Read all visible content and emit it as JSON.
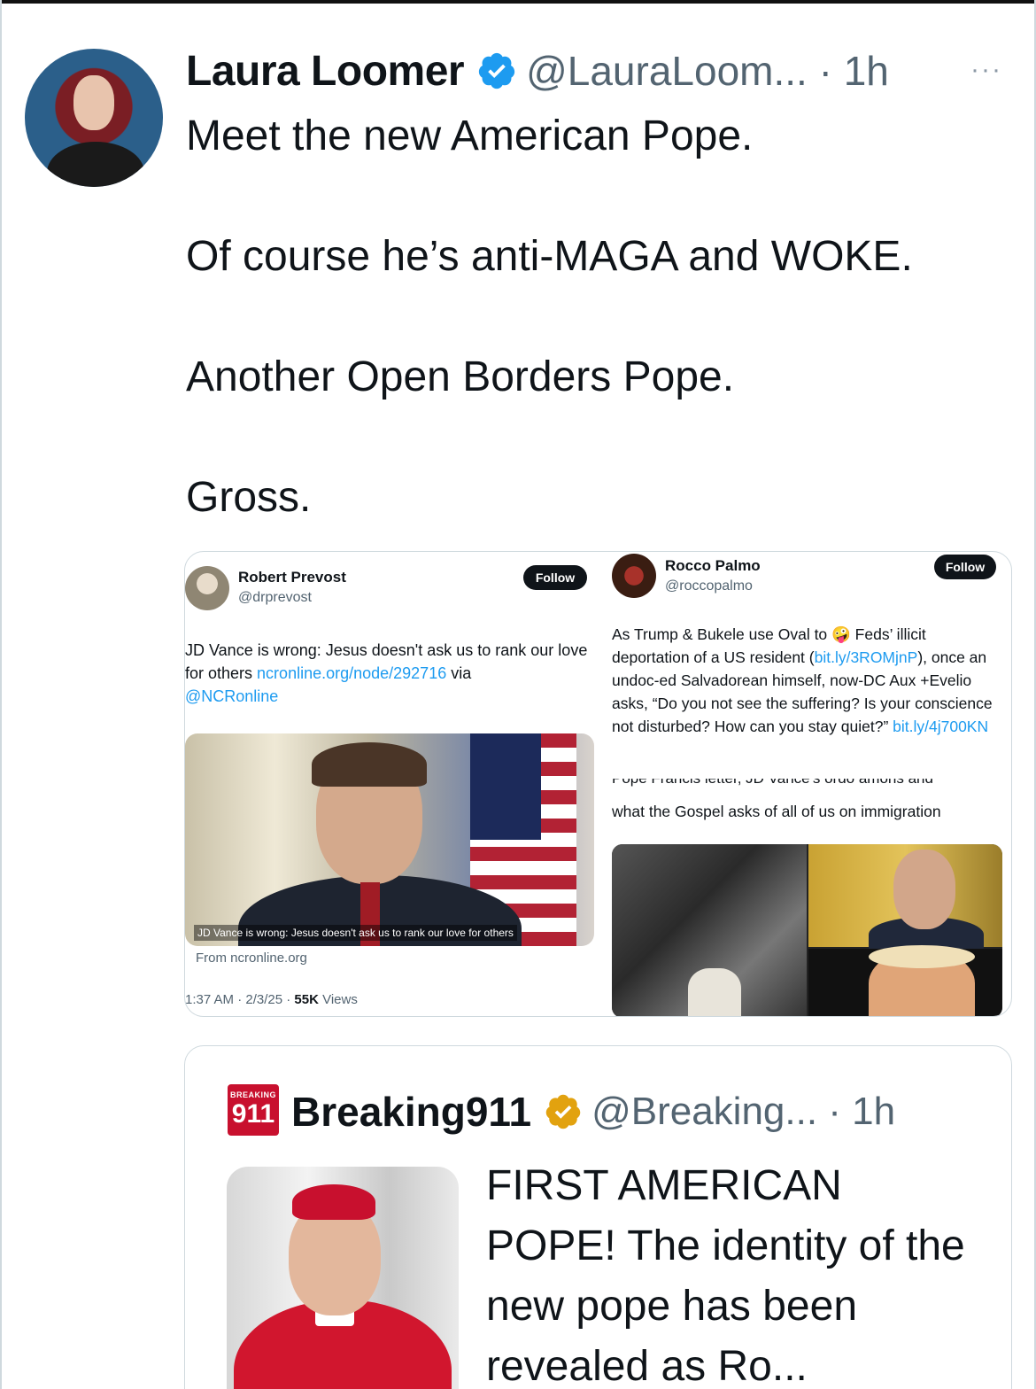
{
  "tweet": {
    "author_name": "Laura Loomer",
    "handle_time": "@LauraLoom... · 1h",
    "more_label": "···",
    "text": "Meet the new American Pope.\n\nOf course he’s anti-MAGA and WOKE.\n\nAnother Open Borders Pope.\n\nGross."
  },
  "media": {
    "left": {
      "name": "Robert Prevost",
      "handle": "@drprevost",
      "follow_label": "Follow",
      "text_plain": "JD Vance is wrong: Jesus doesn't ask us to rank our love for others ",
      "link": "ncronline.org/node/292716",
      "text_via": " via",
      "mention": "@NCRonline",
      "image_caption": "JD Vance is wrong: Jesus doesn't ask us to rank our love for others",
      "from_label": "From ncronline.org",
      "time": "1:37 AM · 2/3/25 · ",
      "views_count": "55K",
      "views_label": " Views"
    },
    "right": {
      "name": "Rocco Palmo",
      "handle": "@roccopalmo",
      "follow_label": "Follow",
      "text_part1": "As Trump & Bukele use Oval to 🤪 Feds’ illicit deportation of a US resident (",
      "link1": "bit.ly/3ROMjnP",
      "text_part2": "), once an undoc-ed Salvadorean himself, now-DC Aux +Evelio asks, “Do you not see the suffering? Is your conscience not disturbed? How can you stay quiet?” ",
      "link2": "bit.ly/4j700KN",
      "cut_line": "Pope Francis letter, JD Vance's ordo amoris and",
      "subtext": "what the Gospel asks of all of us on immigration"
    }
  },
  "quote": {
    "logo_top": "BREAKING",
    "logo_num": "911",
    "name": "Breaking911",
    "handle_time": "@Breaking... · 1h",
    "text": "FIRST AMERICAN POPE! The identity of the new pope has been revealed as Ro..."
  },
  "colors": {
    "verified_blue": "#1d9bf0",
    "verified_gold": "#e2a20f",
    "link": "#1d9bf0",
    "brand_red": "#c8102e"
  }
}
